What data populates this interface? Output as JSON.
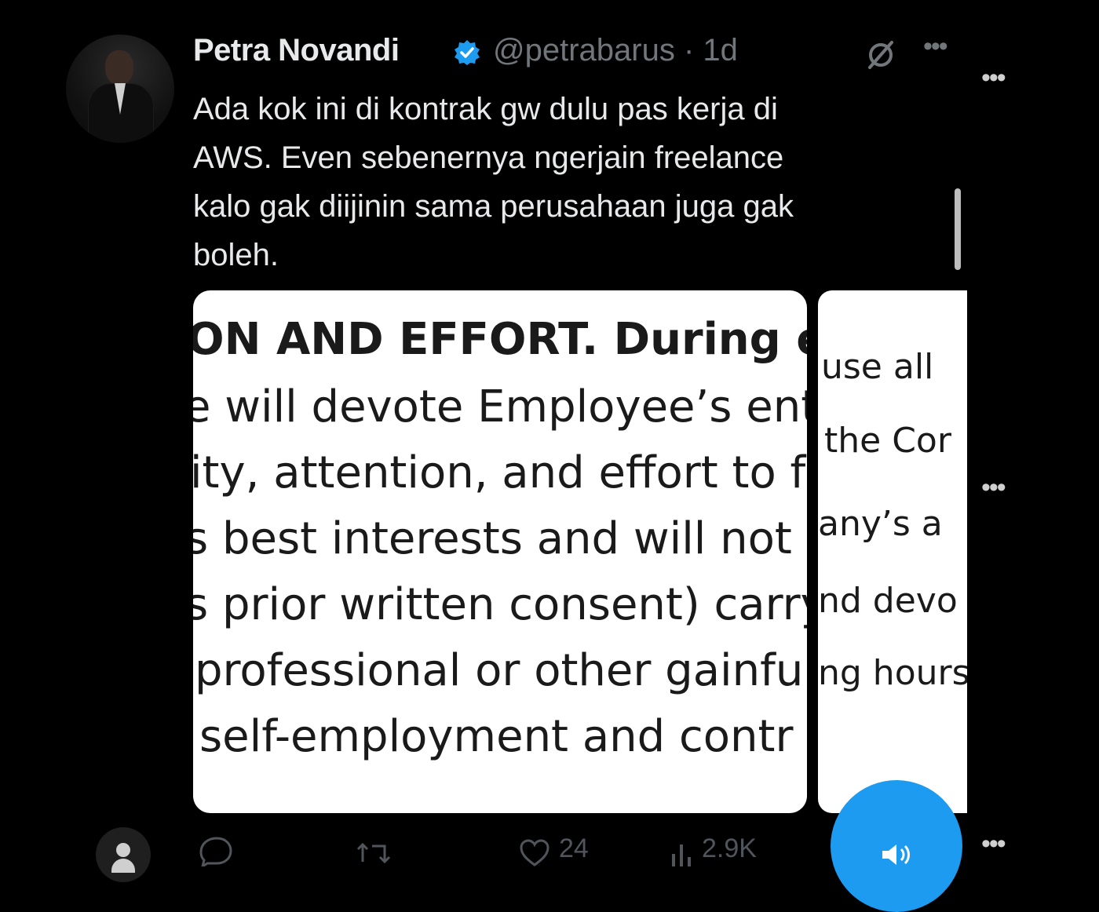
{
  "tweet": {
    "author_name": "Petra Novandi",
    "handle_time": "@petrabarus · 1d",
    "text_lines": [
      "Ada kok ini di kontrak gw dulu pas kerja di",
      "AWS. Even sebenernya ngerjain freelance",
      "kalo gak diijinin sama perusahaan juga gak",
      "boleh."
    ]
  },
  "media": {
    "card1_lines": [
      "ON AND EFFORT. During em",
      "e will devote Employee’s ent",
      "ity, attention, and effort to f",
      "s best interests and will not (",
      "s prior written consent) carry",
      "professional or other gainfu",
      "self-employment and contr"
    ],
    "card2_lines": [
      "use  all",
      "the Cor",
      "any’s   a",
      "nd  devo",
      "ng hours"
    ]
  },
  "actions": {
    "reply_count": "",
    "repost_icon_label": "⇅",
    "like_count": "24",
    "views_count": "2.9K"
  },
  "icons": {
    "verified": "verified-badge-icon",
    "more": "more-icon",
    "grok": "slash-circle-icon"
  },
  "colors": {
    "background": "#000000",
    "text_primary": "#e7e9ea",
    "text_secondary": "#71767b",
    "accent_blue": "#1d9bf0"
  }
}
